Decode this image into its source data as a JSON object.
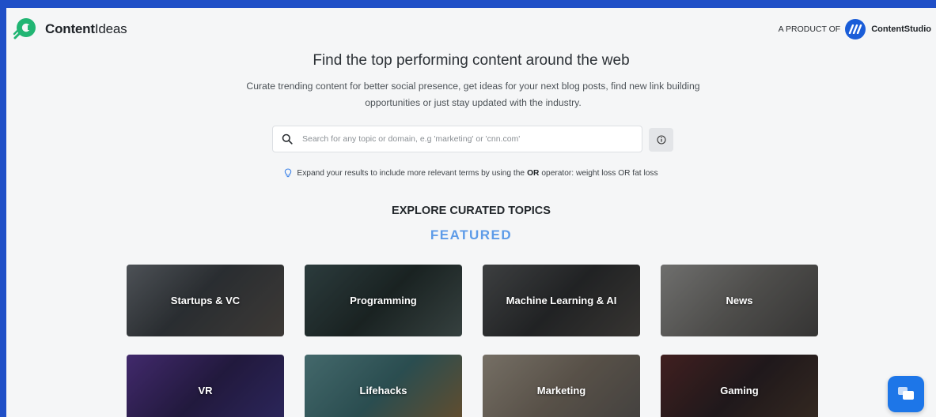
{
  "header": {
    "brand_bold": "Content",
    "brand_light": "Ideas",
    "product_label": "A PRODUCT OF",
    "product_name": "ContentStudio"
  },
  "hero": {
    "title": "Find the top performing content around the web",
    "subtitle": "Curate trending content for better social presence, get ideas for your next blog posts, find new link building opportunities or just stay updated with the industry."
  },
  "search": {
    "value": "",
    "placeholder": "Search for any topic or domain, e.g 'marketing' or 'cnn.com'"
  },
  "tip": {
    "before": "Expand your results to include more relevant terms by using the",
    "operator": "OR",
    "after": "operator: weight loss OR fat loss"
  },
  "explore": {
    "heading": "EXPLORE CURATED TOPICS",
    "section": "FEATURED"
  },
  "topics": [
    {
      "label": "Startups & VC",
      "color": "#4a4f55"
    },
    {
      "label": "Programming",
      "color": "#34484a"
    },
    {
      "label": "Machine Learning & AI",
      "color": "#3c3e3f"
    },
    {
      "label": "News",
      "color": "#6b6b6a"
    },
    {
      "label": "VR",
      "color": "#3b2a66"
    },
    {
      "label": "Lifehacks",
      "color": "#3e6d72"
    },
    {
      "label": "Marketing",
      "color": "#7d7367"
    },
    {
      "label": "Gaming",
      "color": "#3a2b2b"
    }
  ],
  "colors": {
    "brand_green": "#21b573",
    "accent_blue": "#1a5dd8",
    "featured_blue": "#5d9be8"
  }
}
